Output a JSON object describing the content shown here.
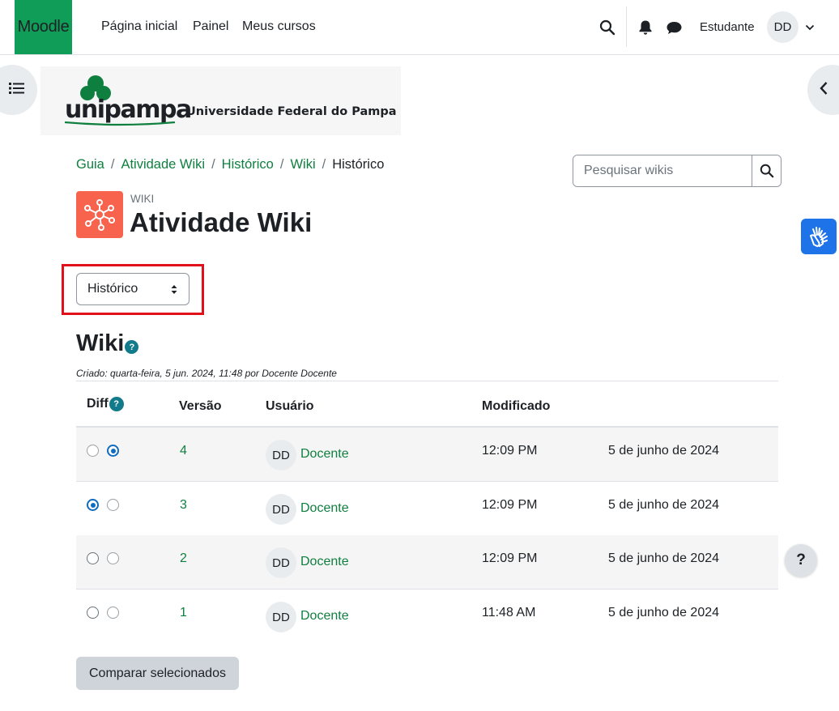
{
  "navbar": {
    "brand": "Moodle",
    "links": [
      "Página inicial",
      "Painel",
      "Meus cursos"
    ],
    "user_name": "Estudante",
    "avatar_initials": "DD"
  },
  "logo": {
    "word": "unipampa",
    "university": "Universidade Federal do Pampa"
  },
  "breadcrumb": [
    "Guia",
    "Atividade Wiki",
    "Histórico",
    "Wiki",
    "Histórico"
  ],
  "search": {
    "placeholder": "Pesquisar wikis"
  },
  "activity": {
    "type_label": "WIKI",
    "title": "Atividade Wiki"
  },
  "view_select": {
    "selected": "Histórico"
  },
  "wiki": {
    "title": "Wiki",
    "created": "Criado: quarta-feira, 5 jun. 2024, 11:48 por Docente Docente"
  },
  "table": {
    "headers": {
      "diff": "Diff",
      "version": "Versão",
      "user": "Usuário",
      "modified": "Modificado"
    },
    "rows": [
      {
        "from_checked": false,
        "to_checked": true,
        "version": "4",
        "initials": "DD",
        "user": "Docente",
        "time": "12:09 PM",
        "date": "5 de junho de 2024"
      },
      {
        "from_checked": true,
        "to_checked": false,
        "version": "3",
        "initials": "DD",
        "user": "Docente",
        "time": "12:09 PM",
        "date": "5 de junho de 2024"
      },
      {
        "from_checked": false,
        "to_checked": false,
        "version": "2",
        "initials": "DD",
        "user": "Docente",
        "time": "12:09 PM",
        "date": "5 de junho de 2024"
      },
      {
        "from_checked": false,
        "to_checked": false,
        "version": "1",
        "initials": "DD",
        "user": "Docente",
        "time": "11:48 AM",
        "date": "5 de junho de 2024"
      }
    ]
  },
  "compare_button": "Comparar selecionados",
  "help_button": "?",
  "colors": {
    "brand": "#0f9d58",
    "link": "#0f7f3f",
    "highlight": "#e0111b",
    "activity_icon": "#f7634d",
    "accessibility": "#1e73e8"
  }
}
